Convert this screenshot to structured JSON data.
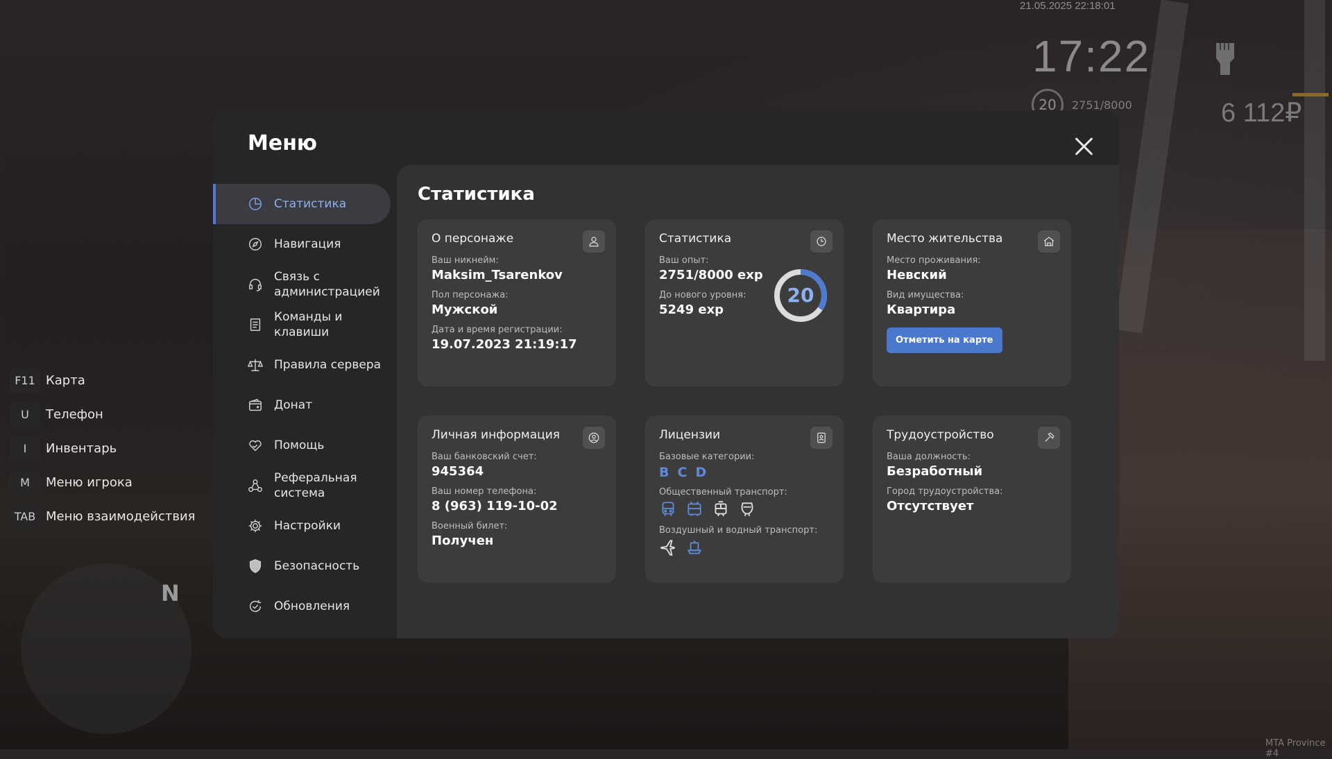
{
  "hud": {
    "datetime": "21.05.2025 22:18:01",
    "clock": "17:22",
    "level": "20",
    "exp": "2751/8000",
    "money": "6 112₽"
  },
  "keybinds": [
    {
      "key": "F11",
      "label": "Карта"
    },
    {
      "key": "U",
      "label": "Телефон"
    },
    {
      "key": "I",
      "label": "Инвентарь"
    },
    {
      "key": "M",
      "label": "Меню игрока"
    },
    {
      "key": "TAB",
      "label": "Меню взаимодействия"
    }
  ],
  "minimap": {
    "north": "N"
  },
  "watermark": "MTA Province #4",
  "menu": {
    "title": "Меню",
    "sidebar": [
      {
        "label": "Статистика",
        "icon": "pie-chart-icon",
        "active": true
      },
      {
        "label": "Навигация",
        "icon": "compass-icon"
      },
      {
        "label": "Связь с\nадминистрацией",
        "icon": "headset-icon"
      },
      {
        "label": "Команды и\nклавиши",
        "icon": "document-list-icon"
      },
      {
        "label": "Правила сервера",
        "icon": "scales-icon"
      },
      {
        "label": "Донат",
        "icon": "wallet-icon"
      },
      {
        "label": "Помощь",
        "icon": "heart-hand-icon"
      },
      {
        "label": "Реферальная\nсистема",
        "icon": "people-network-icon"
      },
      {
        "label": "Настройки",
        "icon": "gear-icon"
      },
      {
        "label": "Безопасность",
        "icon": "shield-icon"
      },
      {
        "label": "Обновления",
        "icon": "refresh-check-icon"
      }
    ]
  },
  "stats": {
    "title": "Статистика",
    "about": {
      "title": "О персонаже",
      "nick_label": "Ваш никнейм:",
      "nick": "Maksim_Tsarenkov",
      "gender_label": "Пол персонажа:",
      "gender": "Мужской",
      "reg_label": "Дата и время регистрации:",
      "reg": "19.07.2023 21:19:17"
    },
    "statistics": {
      "title": "Статистика",
      "exp_label": "Ваш опыт:",
      "exp": "2751/8000 exp",
      "next_label": "До нового уровня:",
      "next": "5249 exp",
      "level": "20",
      "progress": 0.344
    },
    "residence": {
      "title": "Место жительства",
      "place_label": "Место проживания:",
      "place": "Невский",
      "type_label": "Вид имущества:",
      "type": "Квартира",
      "button": "Отметить на карте"
    },
    "personal": {
      "title": "Личная информация",
      "bank_label": "Ваш банковский счет:",
      "bank": "945364",
      "phone_label": "Ваш номер телефона:",
      "phone": "8 (963) 119-10-02",
      "military_label": "Военный билет:",
      "military": "Получен"
    },
    "licenses": {
      "title": "Лицензии",
      "base_label": "Базовые категории:",
      "categories": [
        "B",
        "C",
        "D"
      ],
      "public_label": "Общественный транспорт:",
      "air_label": "Воздушный и водный транспорт:"
    },
    "job": {
      "title": "Трудоустройство",
      "position_label": "Ваша должность:",
      "position": "Безработный",
      "city_label": "Город трудоустройства:",
      "city": "Отсутствует"
    }
  },
  "colors": {
    "accent": "#4e7bd0",
    "category_blue": "#5e8ad8",
    "panel": "#262626",
    "content": "#323232",
    "card": "#3c3c3c"
  }
}
